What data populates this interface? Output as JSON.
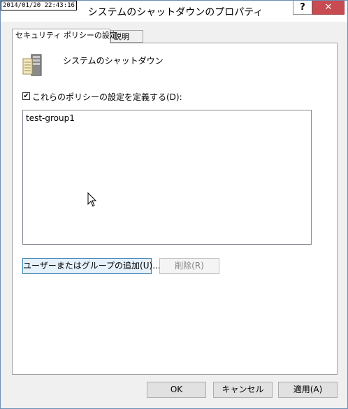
{
  "window": {
    "timestamp": "2014/01/20 22:43:16",
    "title": "システムのシャットダウンのプロパティ",
    "help_label": "?",
    "close_label": "✕"
  },
  "tabs": [
    {
      "label": "セキュリティ ポリシーの設定",
      "active": true
    },
    {
      "label": "説明",
      "active": false
    }
  ],
  "policy": {
    "name": "システムのシャットダウン",
    "icon": "server-icon",
    "define_checkbox_label": "これらのポリシーの設定を定義する(D):",
    "define_checked": true,
    "check_mark": "✔"
  },
  "principals": [
    "test-group1"
  ],
  "buttons": {
    "add": "ユーザーまたはグループの追加(U)...",
    "remove": "削除(R)",
    "ok": "OK",
    "cancel": "キャンセル",
    "apply": "適用(A)"
  },
  "colors": {
    "close_button": "#c74b50",
    "focus_border": "#3c7fb1"
  }
}
